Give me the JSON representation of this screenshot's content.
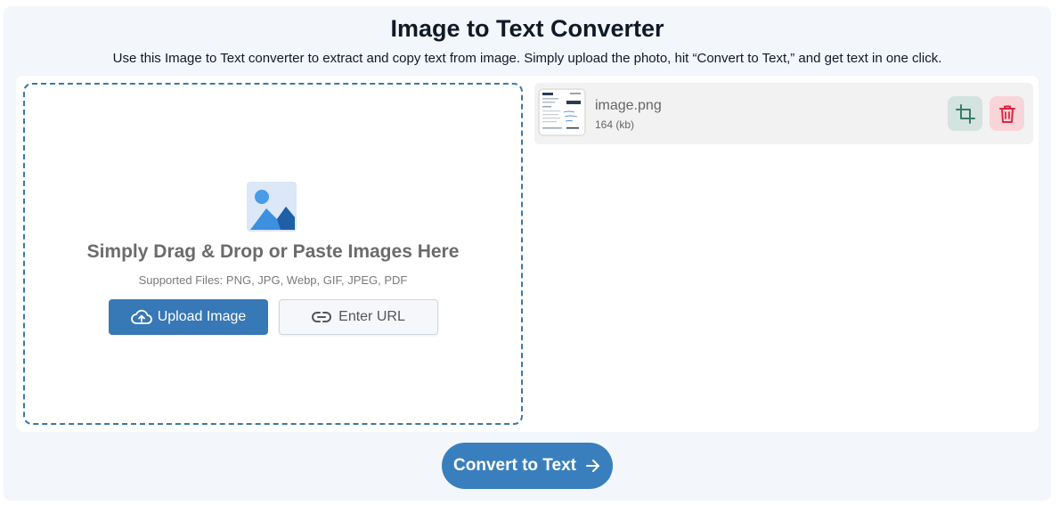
{
  "header": {
    "title": "Image to Text Converter",
    "subtitle": "Use this Image to Text converter to extract and copy text from image. Simply upload the photo, hit “Convert to Text,” and get text in one click."
  },
  "dropzone": {
    "illustration_icon": "image-placeholder-icon",
    "heading": "Simply Drag & Drop or Paste Images Here",
    "supported_files": "Supported Files: PNG, JPG, Webp, GIF, JPEG, PDF",
    "upload_label": "Upload Image",
    "upload_icon": "cloud-upload-icon",
    "url_label": "Enter URL",
    "url_icon": "link-icon"
  },
  "file": {
    "name": "image.png",
    "size": "164 (kb)",
    "crop_icon": "crop-icon",
    "delete_icon": "trash-icon"
  },
  "actions": {
    "convert_label": "Convert to Text",
    "convert_icon": "arrow-right-icon"
  },
  "colors": {
    "primary": "#3778b7",
    "dropzone_border": "#3a78a8",
    "crop_bg": "#d3e3df",
    "crop_icon": "#3a7a6a",
    "delete_bg": "#f9d4d8",
    "delete_icon": "#e0243f",
    "page_bg": "#f3f6fb"
  }
}
